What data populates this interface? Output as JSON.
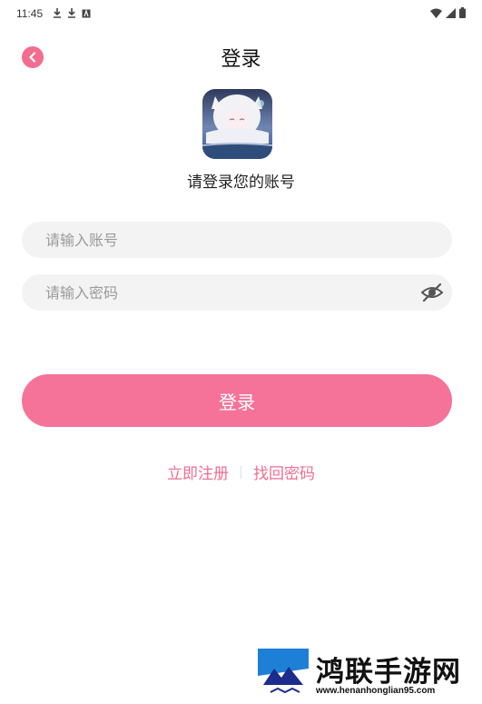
{
  "status": {
    "time": "11:45",
    "left_icons": [
      "download-icon",
      "download-icon",
      "a-icon"
    ],
    "right_icons": [
      "wifi-icon",
      "signal-icon",
      "battery-icon"
    ]
  },
  "header": {
    "title": "登录",
    "back_icon": "chevron-left-icon"
  },
  "logo": {
    "alt": "app-logo"
  },
  "subtitle": "请登录您的账号",
  "form": {
    "account_placeholder": "请输入账号",
    "account_value": "",
    "password_placeholder": "请输入密码",
    "password_value": "",
    "password_toggle_icon": "eye-off-icon"
  },
  "login_button": "登录",
  "links": {
    "register": "立即注册",
    "forgot": "找回密码"
  },
  "watermark": {
    "text": "鸿联手游网",
    "url": "www.henanhonglian95.com"
  },
  "colors": {
    "accent": "#f57399",
    "link": "#ef6e92",
    "input_bg": "#f3f3f3"
  }
}
